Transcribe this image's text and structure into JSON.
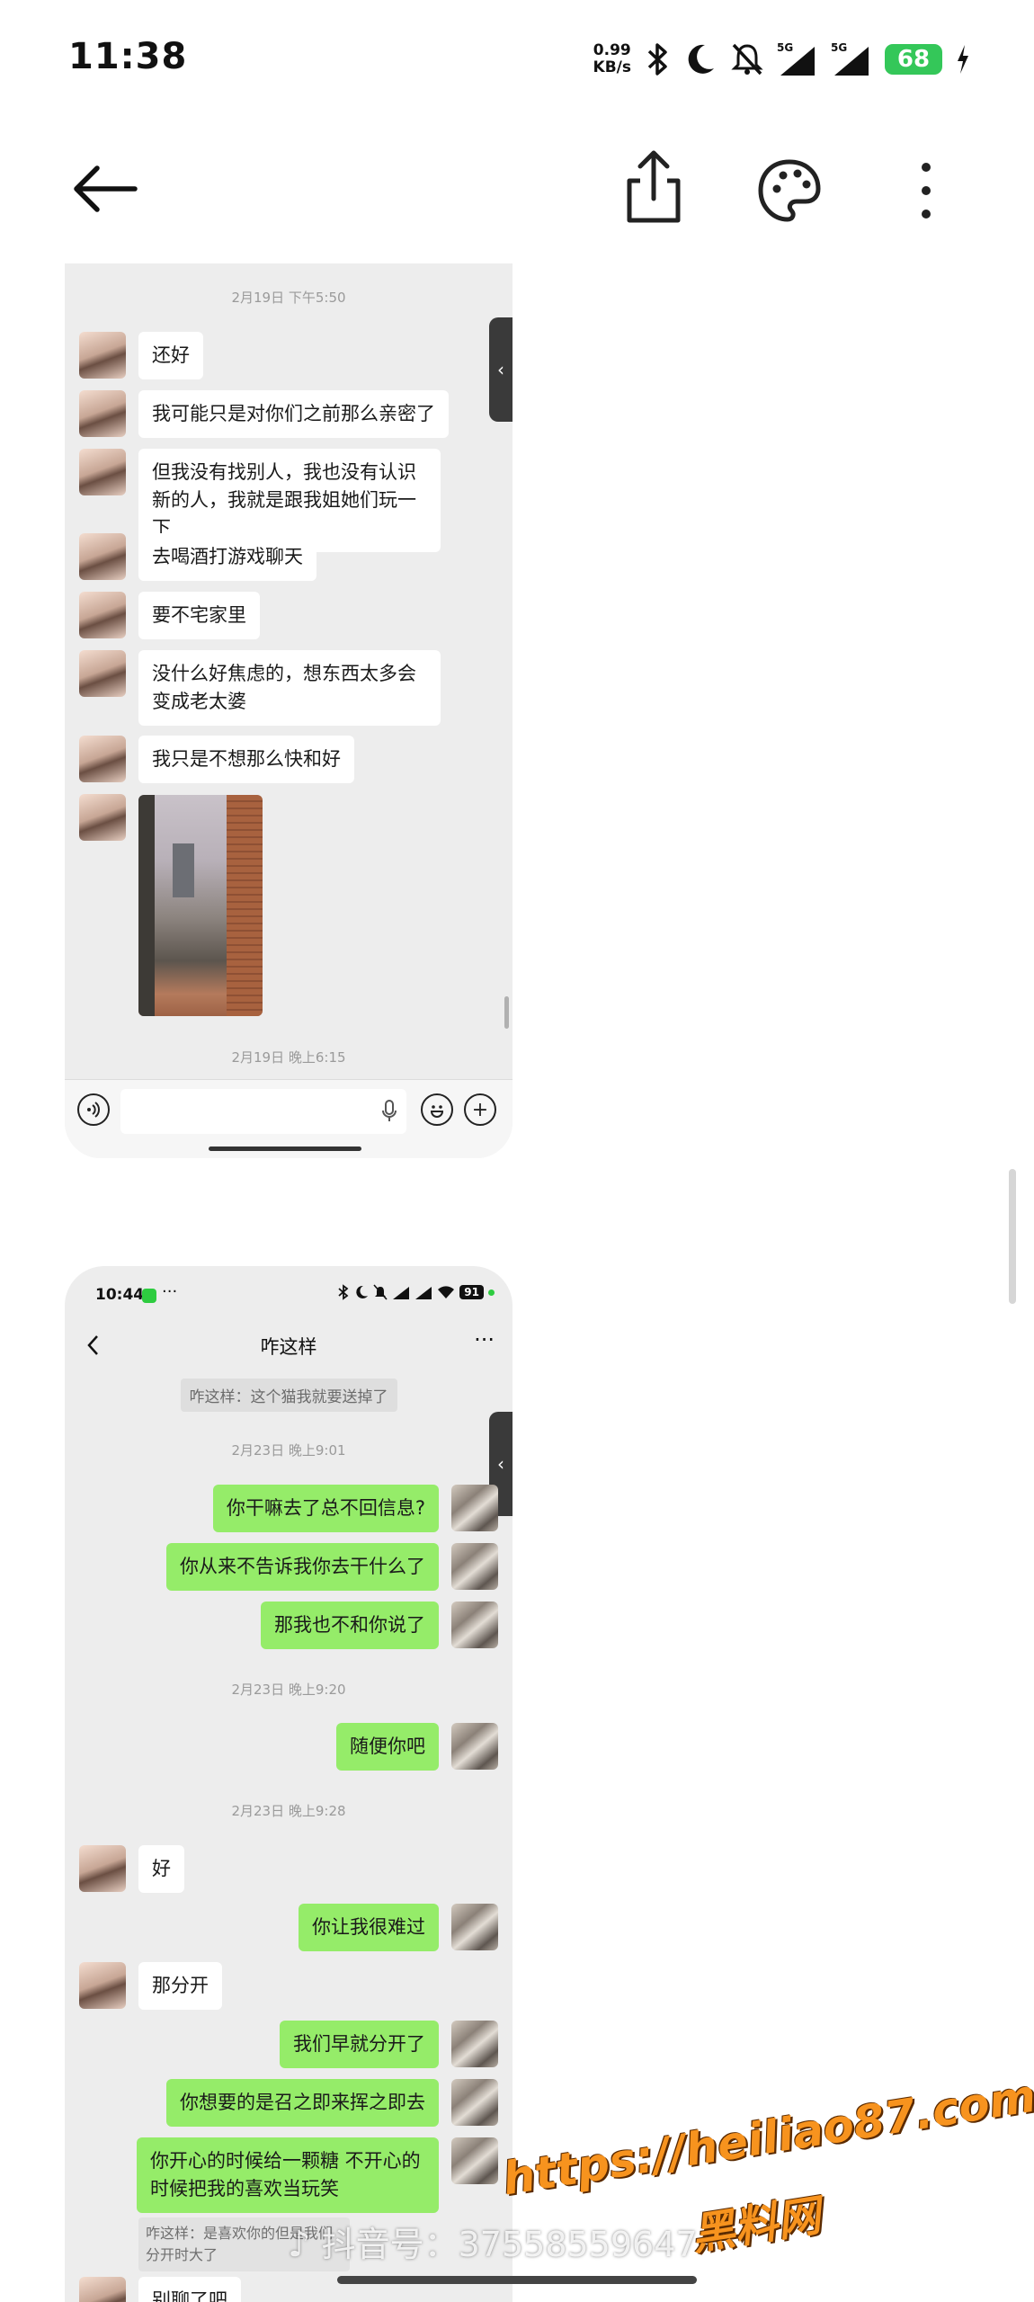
{
  "status_bar": {
    "time": "11:38",
    "net_speed_value": "0.99",
    "net_speed_unit": "KB/s",
    "sim1": "5G",
    "sim2": "5G",
    "battery": "68",
    "icons": [
      "bluetooth-icon",
      "moon-icon",
      "mute-icon",
      "signal-icon",
      "signal-icon",
      "charging-icon"
    ]
  },
  "toolbar": {
    "back_icon": "arrow-left-icon",
    "share_icon": "share-icon",
    "palette_icon": "palette-icon",
    "more_icon": "more-vertical-icon"
  },
  "card1": {
    "timestamp_top": "2月19日 下午5:50",
    "messages": [
      {
        "text": "还好"
      },
      {
        "text": "我可能只是对你们之前那么亲密了"
      },
      {
        "text": "但我没有找别人，我也没有认识新的人，我就是跟我姐她们玩一下"
      },
      {
        "text": "去喝酒打游戏聊天"
      },
      {
        "text": "要不宅家里"
      },
      {
        "text": "没什么好焦虑的，想东西太多会变成老太婆"
      },
      {
        "text": "我只是不想那么快和好"
      }
    ],
    "timestamp_bottom": "2月19日 晚上6:15"
  },
  "card2": {
    "time": "10:44",
    "battery": "91",
    "chat_title": "咋这样",
    "sys_note": "咋这样：这个猫我就要送掉了",
    "ts1": "2月23日 晚上9:01",
    "sent1": "你干嘛去了总不回信息?",
    "sent2": "你从来不告诉我你去干什么了",
    "sent3": "那我也不和你说了",
    "ts2": "2月23日 晚上9:20",
    "sent4": "随便你吧",
    "ts3": "2月23日 晚上9:28",
    "recv1": "好",
    "sent5": "你让我很难过",
    "recv2": "那分开",
    "sent6": "我们早就分开了",
    "sent7": "你想要的是召之即来挥之即去",
    "sent8": "你开心的时候给一颗糖 不开心的时候把我的喜欢当玩笑",
    "quote": "咋这样：是喜欢你的但是我们分开时大了",
    "recv3": "别聊了吧"
  },
  "watermark": {
    "url": "https://heiliao87.com",
    "name": "黑料网",
    "douyin": "抖音号：37558559647"
  }
}
